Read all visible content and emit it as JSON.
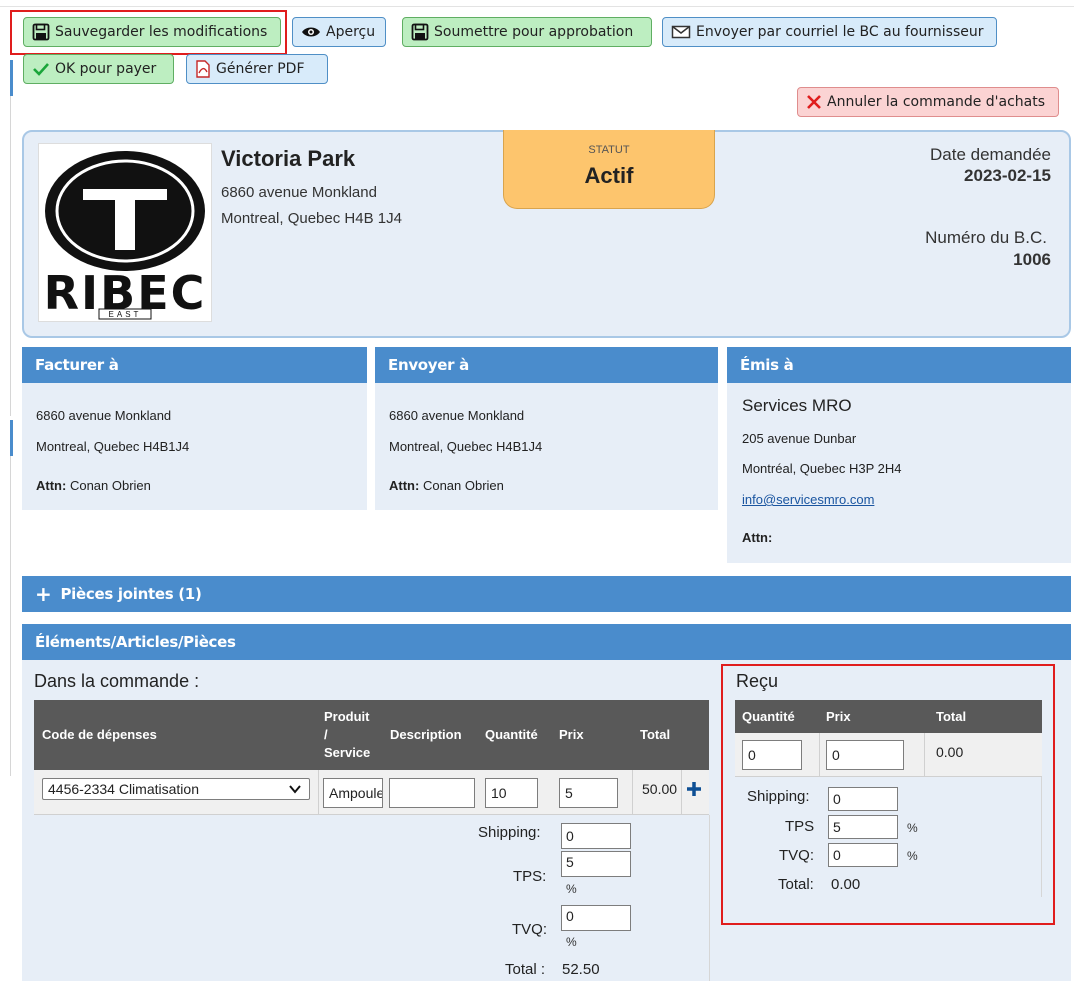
{
  "toolbar": {
    "save_label": "Sauvegarder les modifications",
    "preview_label": "Aperçu",
    "submit_label": "Soumettre pour approbation",
    "email_label": "Envoyer par courriel le BC au fournisseur",
    "ok_pay_label": "OK pour payer",
    "pdf_label": "Générer PDF",
    "cancel_label": "Annuler la commande d'achats"
  },
  "header": {
    "logo_text": "RIBEC",
    "logo_subtext": "EAST",
    "company_name": "Victoria Park",
    "address_line1": "6860 avenue Monkland",
    "address_line2": "Montreal, Quebec H4B 1J4",
    "status_label": "STATUT",
    "status_value": "Actif",
    "date_label": "Date demandée",
    "date_value": "2023-02-15",
    "po_label": "Numéro du B.C.",
    "po_value": "1006"
  },
  "bill_to": {
    "title": "Facturer à",
    "line1": "6860 avenue Monkland",
    "line2": "Montreal, Quebec H4B1J4",
    "attn_label": "Attn:",
    "attn_value": "Conan Obrien"
  },
  "ship_to": {
    "title": "Envoyer à",
    "line1": "6860 avenue Monkland",
    "line2": "Montreal, Quebec H4B1J4",
    "attn_label": "Attn:",
    "attn_value": "Conan Obrien"
  },
  "issued_to": {
    "title": "Émis à",
    "name": "Services MRO",
    "line1": "205 avenue Dunbar",
    "line2": "Montréal, Quebec H3P 2H4",
    "email": "info@servicesmro.com",
    "attn_label": "Attn:"
  },
  "attachments": {
    "title": "Pièces jointes (1)"
  },
  "items": {
    "title": "Éléments/Articles/Pièces",
    "in_order_label": "Dans la commande :",
    "columns": {
      "expense_code": "Code de dépenses",
      "product_l1": "Produit",
      "product_l2": "/",
      "product_l3": "Service",
      "description": "Description",
      "quantity": "Quantité",
      "price": "Prix",
      "total": "Total"
    },
    "row": {
      "expense_code": "4456-2334 Climatisation",
      "product": "Ampoule",
      "description": "",
      "quantity": "10",
      "price": "5",
      "total": "50.00"
    },
    "summary": {
      "shipping_label": "Shipping:",
      "shipping_value": "0",
      "tps_label": "TPS:",
      "tps_value": "5",
      "tvq_label": "TVQ:",
      "tvq_value": "0",
      "percent": "%",
      "total_label": "Total :",
      "total_value": "52.50"
    }
  },
  "received": {
    "title": "Reçu",
    "columns": {
      "quantity": "Quantité",
      "price": "Prix",
      "total": "Total"
    },
    "row": {
      "quantity": "0",
      "price": "0",
      "total": "0.00"
    },
    "shipping_label": "Shipping:",
    "shipping_value": "0",
    "tps_label": "TPS",
    "tps_value": "5",
    "tvq_label": "TVQ:",
    "tvq_value": "0",
    "percent": "%",
    "total_label": "Total:",
    "total_value": "0.00"
  }
}
